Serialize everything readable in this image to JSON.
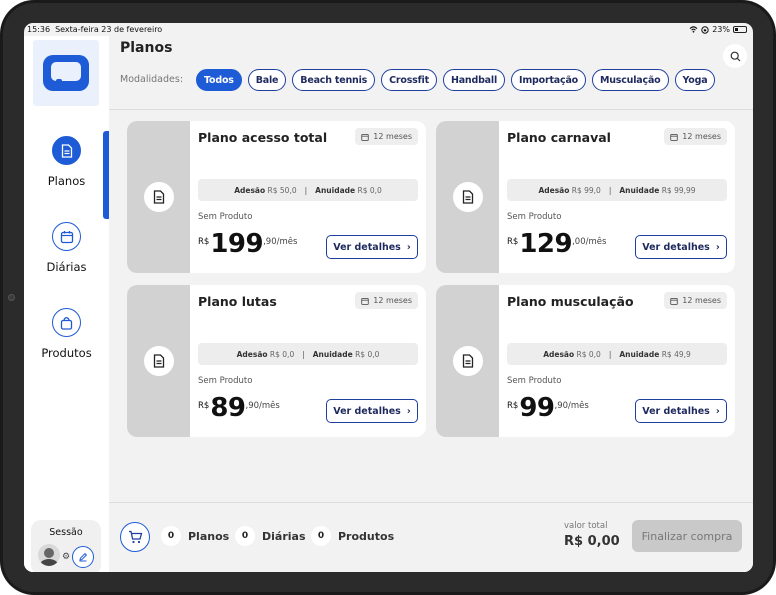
{
  "status_bar": {
    "time": "15:36",
    "date": "Sexta-feira 23 de fevereiro",
    "battery": "23%"
  },
  "sidebar": {
    "items": [
      {
        "label": "Planos",
        "icon": "document-icon",
        "active": true
      },
      {
        "label": "Diárias",
        "icon": "calendar-icon",
        "active": false
      },
      {
        "label": "Produtos",
        "icon": "bag-icon",
        "active": false
      }
    ],
    "session_label": "Sessão"
  },
  "header": {
    "title": "Planos",
    "modalities_label": "Modalidades:",
    "chips": [
      "Todos",
      "Bale",
      "Beach tennis",
      "Crossfit",
      "Handball",
      "Importação",
      "Musculação",
      "Yoga"
    ],
    "active_chip": "Todos"
  },
  "plans": [
    {
      "title": "Plano acesso total",
      "duration": "12 meses",
      "adesao_label": "Adesão",
      "adesao": "R$ 50,0",
      "anuidade_label": "Anuidade",
      "anuidade": "R$ 0,0",
      "product": "Sem Produto",
      "currency": "R$",
      "price_int": "199",
      "price_dec": ",90/mês",
      "button": "Ver detalhes"
    },
    {
      "title": "Plano carnaval",
      "duration": "12 meses",
      "adesao_label": "Adesão",
      "adesao": "R$ 99,0",
      "anuidade_label": "Anuidade",
      "anuidade": "R$ 99,99",
      "product": "Sem Produto",
      "currency": "R$",
      "price_int": "129",
      "price_dec": ",00/mês",
      "button": "Ver detalhes"
    },
    {
      "title": "Plano lutas",
      "duration": "12 meses",
      "adesao_label": "Adesão",
      "adesao": "R$ 0,0",
      "anuidade_label": "Anuidade",
      "anuidade": "R$ 0,0",
      "product": "Sem Produto",
      "currency": "R$",
      "price_int": "89",
      "price_dec": ",90/mês",
      "button": "Ver detalhes"
    },
    {
      "title": "Plano musculação",
      "duration": "12 meses",
      "adesao_label": "Adesão",
      "adesao": "R$ 0,0",
      "anuidade_label": "Anuidade",
      "anuidade": "R$ 49,9",
      "product": "Sem Produto",
      "currency": "R$",
      "price_int": "99",
      "price_dec": ",90/mês",
      "button": "Ver detalhes"
    }
  ],
  "footer": {
    "planos_count": "0",
    "planos_label": "Planos",
    "diarias_count": "0",
    "diarias_label": "Diárias",
    "produtos_count": "0",
    "produtos_label": "Produtos",
    "total_label": "valor total",
    "total_value": "R$ 0,00",
    "checkout_label": "Finalizar compra"
  },
  "colors": {
    "accent": "#1e5bd6",
    "dark_accent": "#1e3f9e",
    "background": "#f2f2f2"
  }
}
